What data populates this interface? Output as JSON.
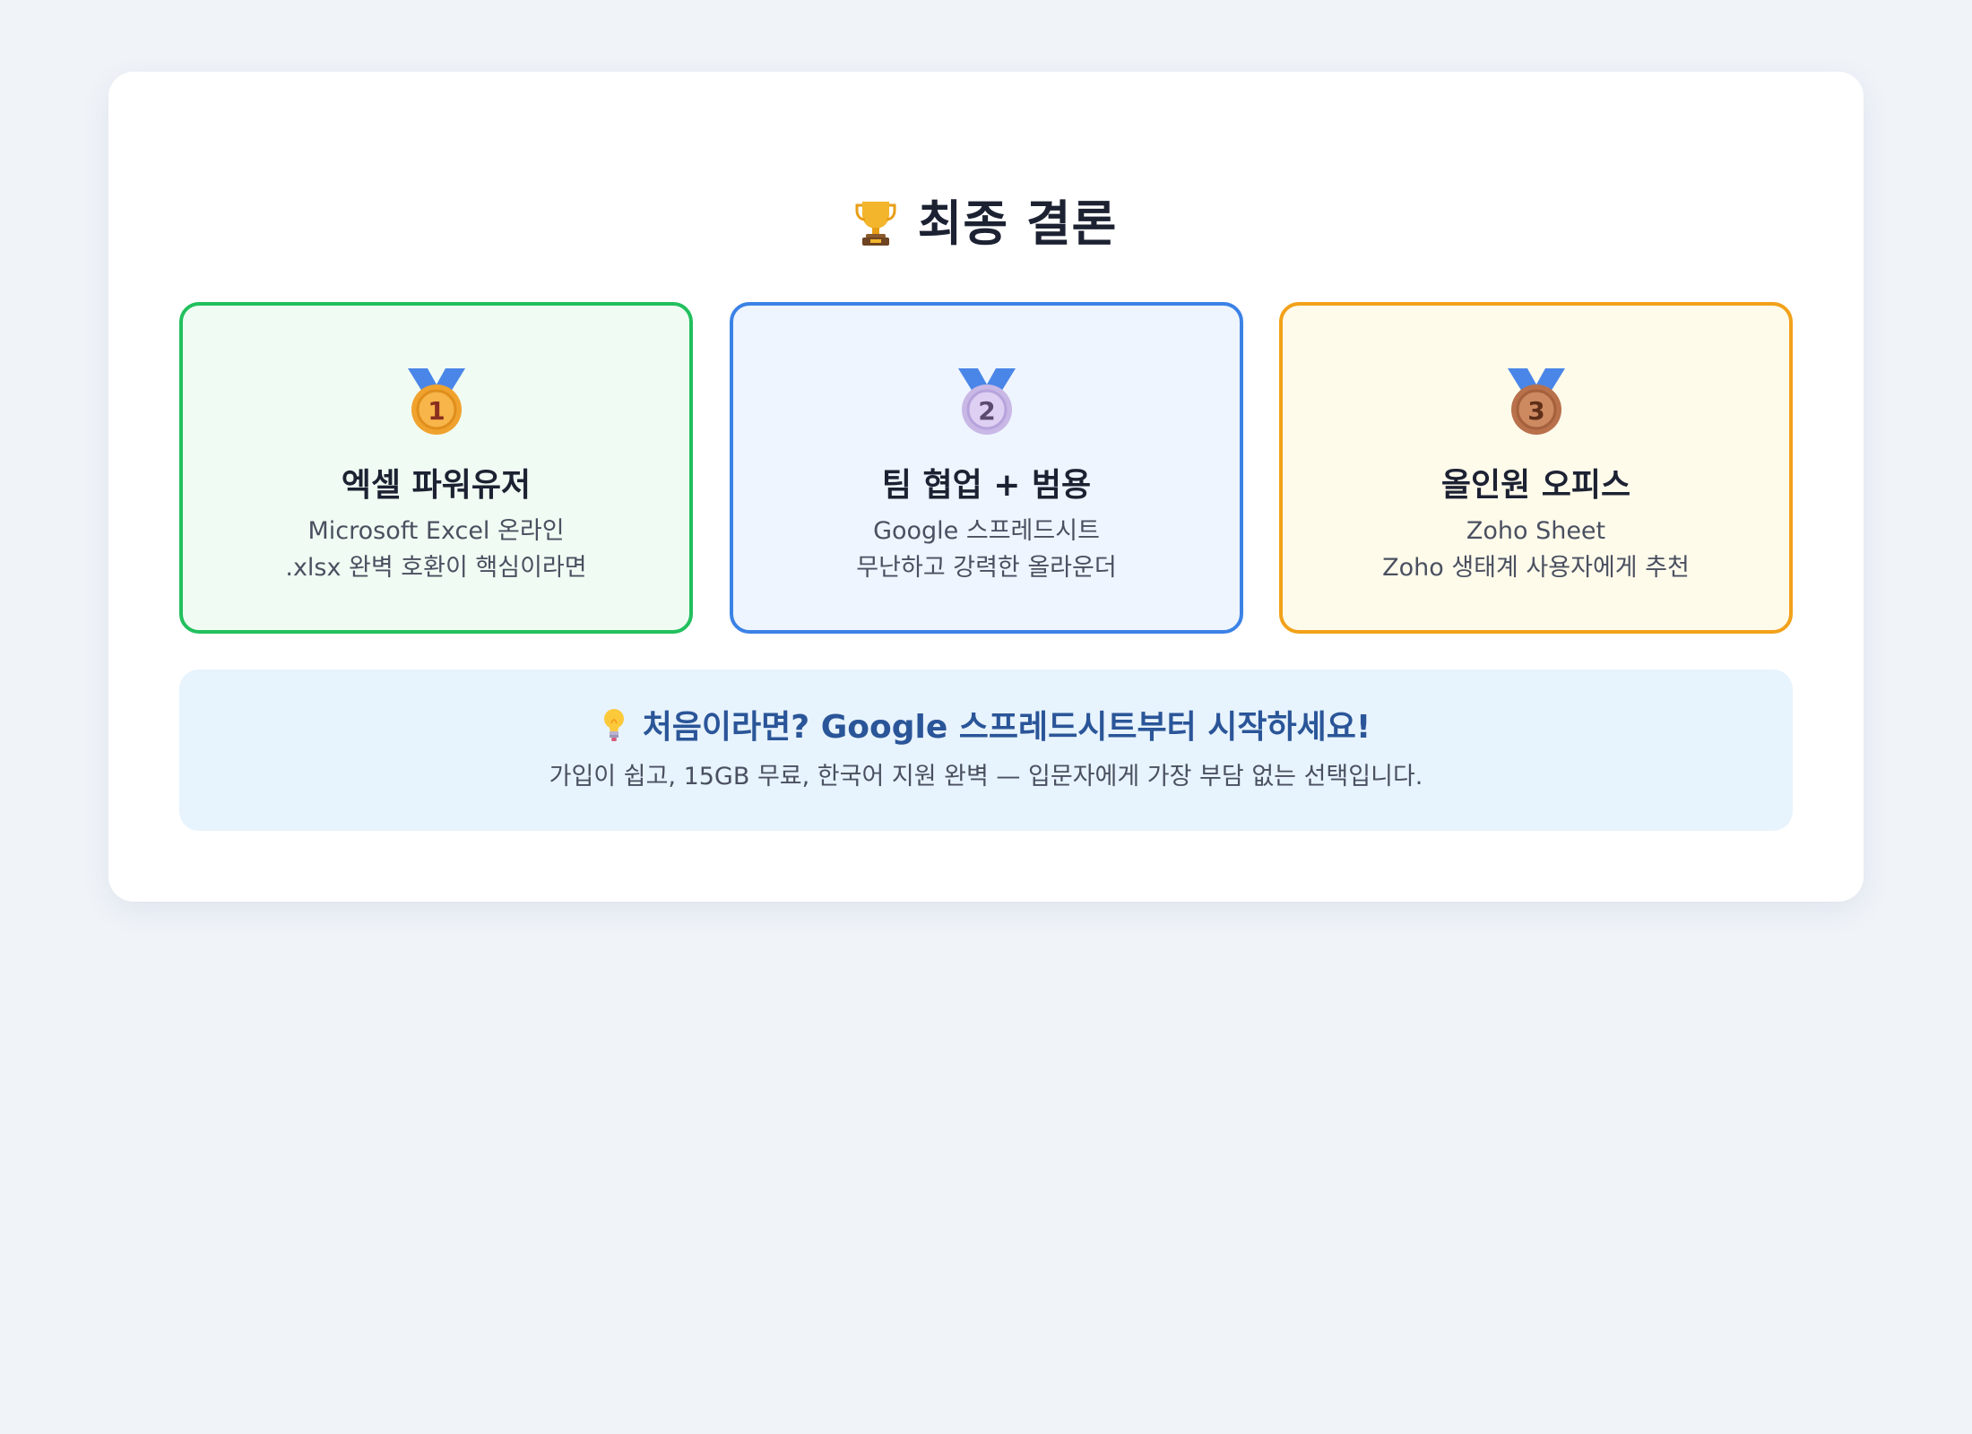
{
  "title": "최종 결론",
  "title_icon": "trophy-icon",
  "colors": {
    "first_border": "#22c05e",
    "second_border": "#3b82e6",
    "third_border": "#f2a11a",
    "tip_title": "#2a5598"
  },
  "rankings": [
    {
      "rank": "1",
      "medal": "gold-medal-icon",
      "title": "엑셀 파워유저",
      "line1": "Microsoft Excel 온라인",
      "line2": ".xlsx 완벽 호환이 핵심이라면"
    },
    {
      "rank": "2",
      "medal": "silver-medal-icon",
      "title": "팀 협업 + 범용",
      "line1": "Google 스프레드시트",
      "line2": "무난하고 강력한 올라운더"
    },
    {
      "rank": "3",
      "medal": "bronze-medal-icon",
      "title": "올인원 오피스",
      "line1": "Zoho Sheet",
      "line2": "Zoho 생태계 사용자에게 추천"
    }
  ],
  "tip": {
    "icon": "lightbulb-icon",
    "title": "처음이라면? Google 스프레드시트부터 시작하세요!",
    "subtitle": "가입이 쉽고, 15GB 무료, 한국어 지원 완벽 — 입문자에게 가장 부담 없는 선택입니다."
  }
}
